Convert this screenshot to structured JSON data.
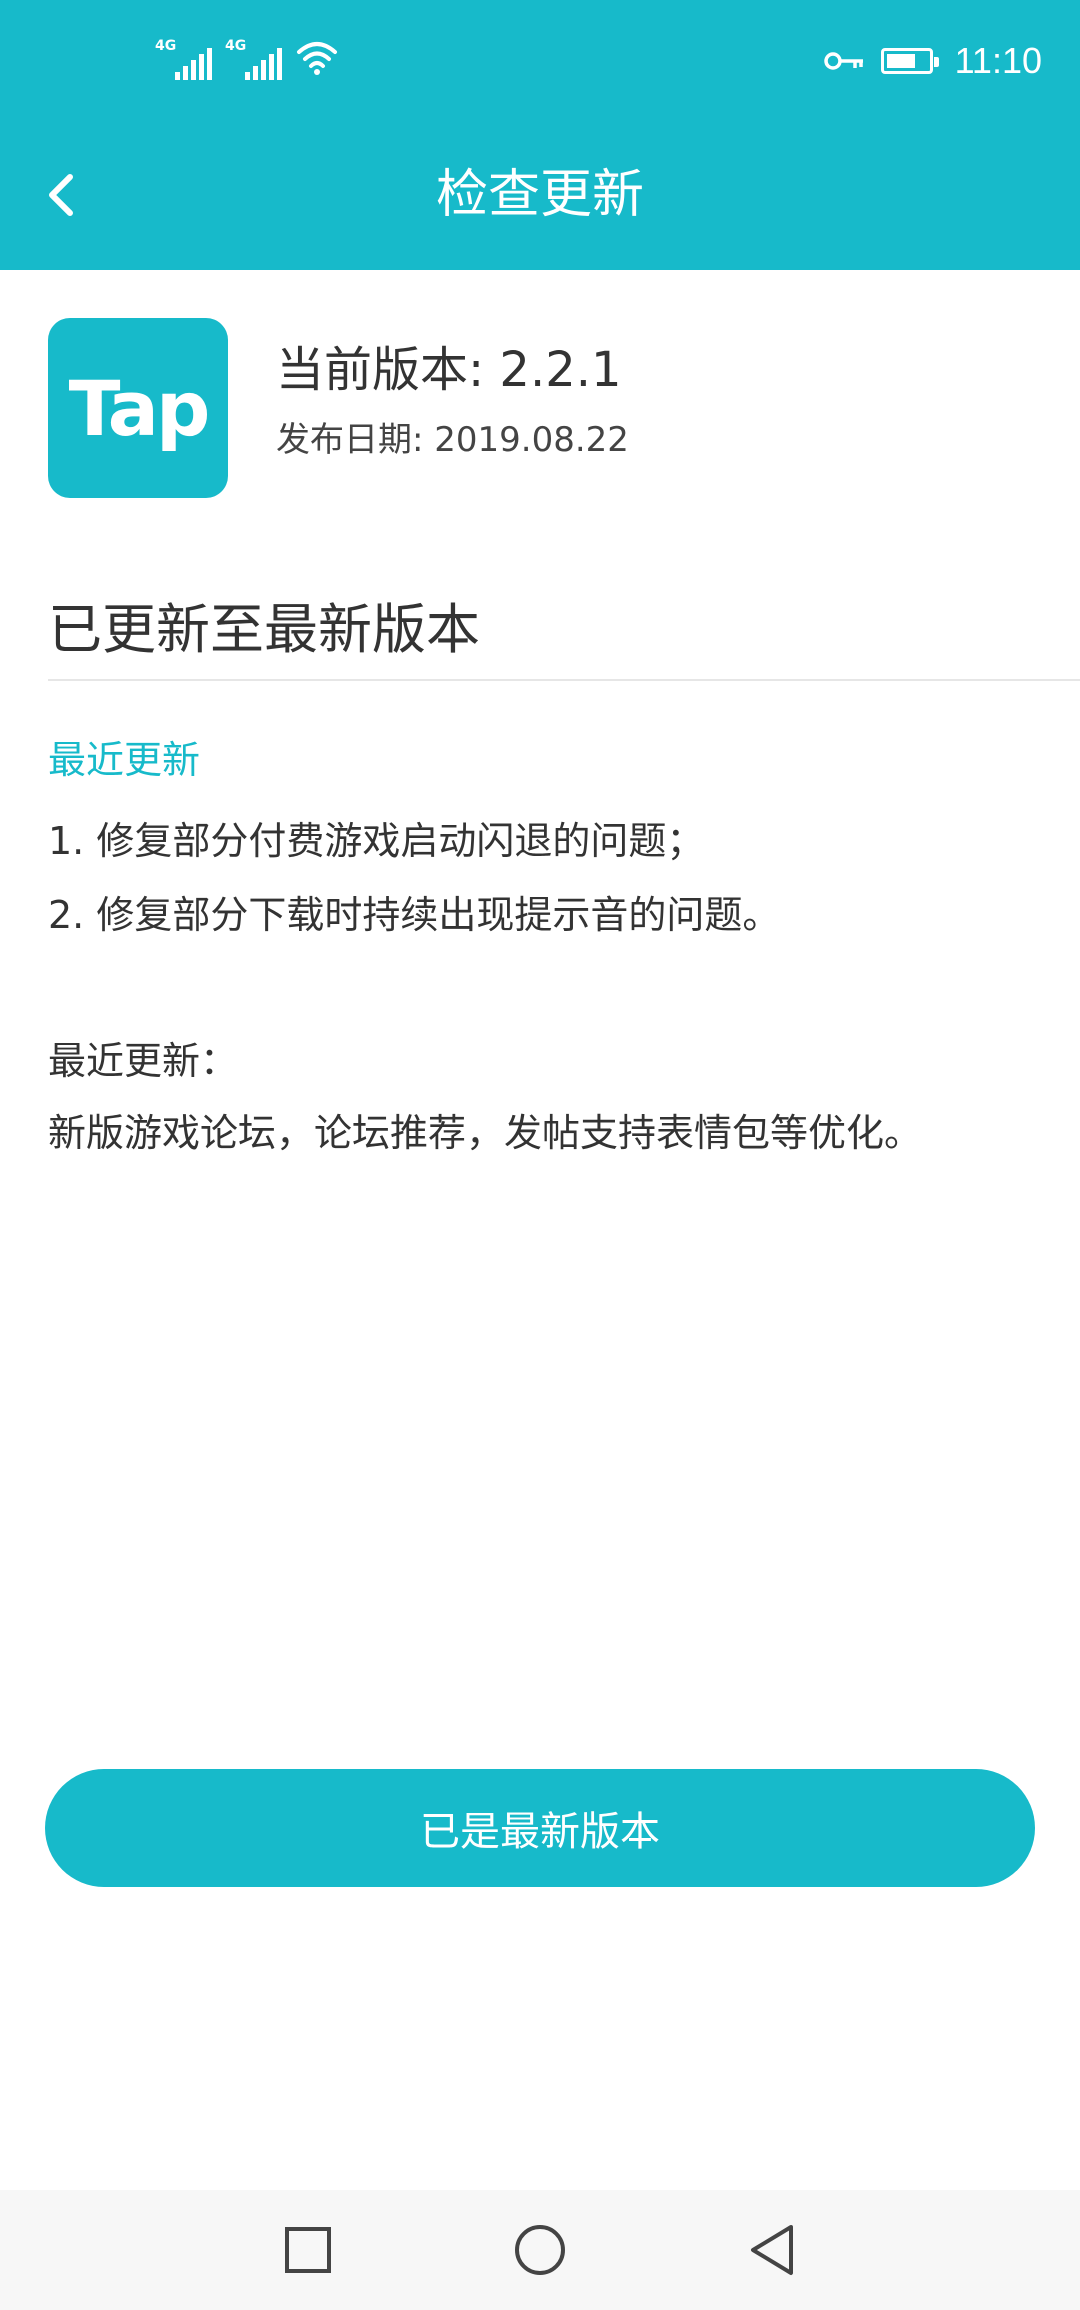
{
  "status_bar": {
    "sim1_label": "4G",
    "sim2_label": "4G",
    "time": "11:10",
    "icons": [
      "signal-icon",
      "wifi-icon",
      "key-icon",
      "battery-icon"
    ],
    "battery_level": 0.7
  },
  "header": {
    "title": "检查更新",
    "back_icon": "chevron-left-icon"
  },
  "app_info": {
    "logo_text": "Tap",
    "current_version": "当前版本: 2.2.1",
    "release_date": "发布日期: 2019.08.22"
  },
  "update_status": "已更新至最新版本",
  "changelog": {
    "section_title": "最近更新",
    "items": [
      "1. 修复部分付费游戏启动闪退的问题；",
      "2. 修复部分下载时持续出现提示音的问题。"
    ],
    "previous_title": "最近更新：",
    "previous_text": "新版游戏论坛，论坛推荐，发帖支持表情包等优化。"
  },
  "action_button": {
    "label": "已是最新版本"
  },
  "system_nav": {
    "icons": [
      "recents-square-icon",
      "home-circle-icon",
      "back-triangle-icon"
    ]
  },
  "colors": {
    "accent": "#17BACA",
    "text": "#333333",
    "background": "#FFFFFF"
  }
}
